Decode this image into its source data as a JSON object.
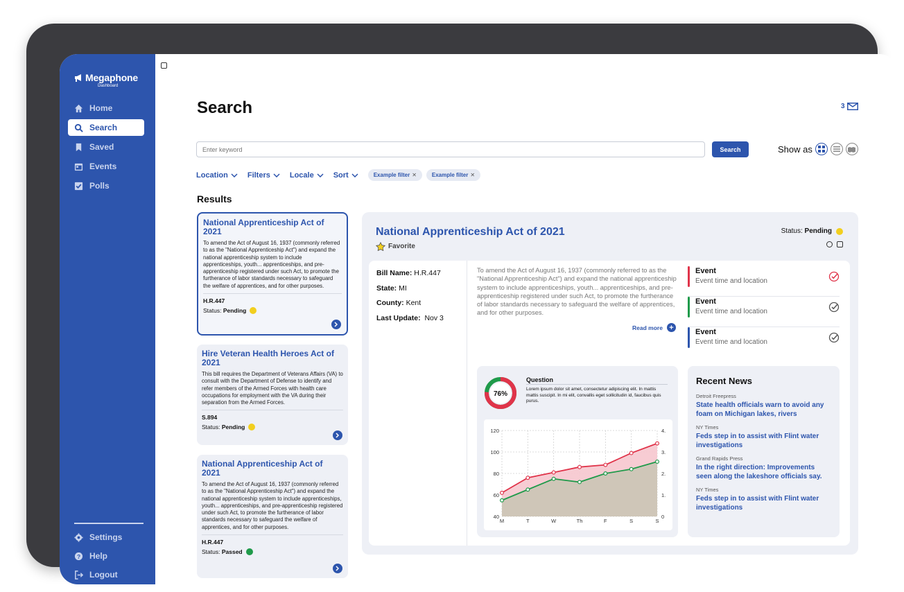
{
  "app": {
    "name": "Megaphone",
    "subtitle": "Dashboard"
  },
  "nav": [
    {
      "label": "Home",
      "icon": "home-icon",
      "active": false
    },
    {
      "label": "Search",
      "icon": "search-icon",
      "active": true
    },
    {
      "label": "Saved",
      "icon": "bookmark-icon",
      "active": false
    },
    {
      "label": "Events",
      "icon": "calendar-icon",
      "active": false
    },
    {
      "label": "Polls",
      "icon": "checkbox-icon",
      "active": false
    }
  ],
  "bottom_nav": [
    {
      "label": "Settings",
      "icon": "gear-icon"
    },
    {
      "label": "Help",
      "icon": "help-icon"
    },
    {
      "label": "Logout",
      "icon": "logout-icon"
    }
  ],
  "header": {
    "title": "Search",
    "inbox_count": "3"
  },
  "search": {
    "placeholder": "Enter keyword",
    "button": "Search",
    "show_as": "Show as"
  },
  "filters": {
    "dropdowns": [
      "Location",
      "Filters",
      "Locale",
      "Sort"
    ],
    "chips": [
      "Example filter",
      "Example filter"
    ]
  },
  "results": {
    "title": "Results",
    "cards": [
      {
        "title": "National Apprenticeship Act of 2021",
        "desc": "To amend the Act of August 16, 1937 (commonly referred to as the \"National Apprenticeship Act\") and expand the national apprenticeship system to include apprenticeships, youth... apprenticeships, and pre-apprenticeship registered under such Act, to promote the furtherance of labor standards necessary to safeguard the welfare of apprentices, and for other purposes.",
        "code": "H.R.447",
        "status_label": "Status:",
        "status": "Pending",
        "status_color": "#f2cf1f"
      },
      {
        "title": "Hire Veteran Health Heroes Act of 2021",
        "desc": "This bill requires the Department of Veterans Affairs (VA) to consult with the Department of Defense to  identify and refer members of the Armed Forces with health care occupations for employment with the VA during their separation from the Armed Forces.",
        "code": "S.894",
        "status_label": "Status:",
        "status": "Pending",
        "status_color": "#f2cf1f"
      },
      {
        "title": "National Apprenticeship Act of 2021",
        "desc": "To amend the Act of August 16, 1937 (commonly referred to as the \"National Apprenticeship Act\") and expand the national apprenticeship system to include apprenticeships, youth... apprenticeships, and pre-apprenticeship registered under such Act, to promote the furtherance of labor standards necessary to safeguard the welfare of apprentices, and for other purposes.",
        "code": "H.R.447",
        "status_label": "Status:",
        "status": "Passed",
        "status_color": "#1f9a4a"
      }
    ]
  },
  "detail": {
    "title": "National Apprenticeship Act of 2021",
    "favorite": "Favorite",
    "status_label": "Status:",
    "status": "Pending",
    "status_color": "#f2cf1f",
    "meta": {
      "bill_label": "Bill Name:",
      "bill": "H.R.447",
      "state_label": "State:",
      "state": "MI",
      "county_label": "County:",
      "county": "Kent",
      "update_label": "Last Update:",
      "update": "Nov 3"
    },
    "summary": "To amend the Act of August 16, 1937 (commonly referred to as the \"National Apprenticeship Act\") and expand the national apprenticeship system to include apprenticeships, youth... apprenticeships, and pre-apprenticeship registered under such Act, to promote the furtherance of labor standards necessary to safeguard the welfare of apprentices, and for other purposes.",
    "read_more": "Read more",
    "events": [
      {
        "title": "Event",
        "sub": "Event time and location",
        "color": "#e0344a",
        "check_color": "#e0344a"
      },
      {
        "title": "Event",
        "sub": "Event time and location",
        "color": "#1f9a4a",
        "check_color": "#555555"
      },
      {
        "title": "Event",
        "sub": "Event time and location",
        "color": "#2d55ad",
        "check_color": "#555555"
      }
    ],
    "question": {
      "percent": "76%",
      "percent_value": 76,
      "title": "Question",
      "text": "Lorem ipsum dolor sit amet, consectetur adipiscing elit. In mattis mattis suscipit. In mi elit, convallis eget sollicitudin id, faucibus quis purus."
    },
    "news_title": "Recent News",
    "news": [
      {
        "source": "Detroit Freepress",
        "headline": "State health officials warn to avoid any foam on Michigan lakes, rivers"
      },
      {
        "source": "NY Times",
        "headline": "Feds step in to assist with Flint water investigations"
      },
      {
        "source": "Grand Rapids Press",
        "headline": "In the right direction: Improvements seen along the lakeshore officials say."
      },
      {
        "source": "NY Times",
        "headline": "Feds step in to assist with Flint water investigations"
      }
    ]
  },
  "colors": {
    "brand": "#2d55ad",
    "pending": "#f2cf1f",
    "passed": "#1f9a4a",
    "red": "#e0344a",
    "green": "#1f9a4a"
  },
  "chart_data": {
    "type": "area",
    "categories": [
      "M",
      "T",
      "W",
      "Th",
      "F",
      "S",
      "S"
    ],
    "ylim": [
      40,
      120
    ],
    "yticks": [
      "120",
      "100",
      "80",
      "60",
      "40"
    ],
    "y2ticks": [
      "4.",
      "3.",
      "2.",
      "1.",
      "0"
    ],
    "series": [
      {
        "values": [
          62,
          76,
          81,
          86,
          88,
          99,
          108
        ],
        "color": "#e0344a"
      },
      {
        "values": [
          55,
          65,
          75,
          72,
          80,
          84,
          91
        ],
        "color": "#1f9a4a"
      }
    ]
  }
}
